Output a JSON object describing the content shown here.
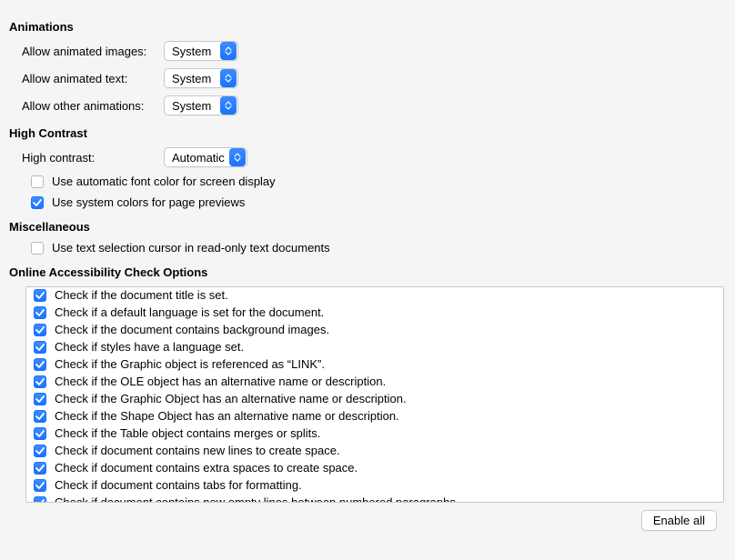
{
  "animations": {
    "header": "Animations",
    "rows": [
      {
        "label": "Allow animated images:",
        "value": "System"
      },
      {
        "label": "Allow animated text:",
        "value": "System"
      },
      {
        "label": "Allow other animations:",
        "value": "System"
      }
    ]
  },
  "highContrast": {
    "header": "High Contrast",
    "selectLabel": "High contrast:",
    "selectValue": "Automatic",
    "opts": [
      {
        "checked": false,
        "label": "Use automatic font color for screen display"
      },
      {
        "checked": true,
        "label": "Use system colors for page previews"
      }
    ]
  },
  "misc": {
    "header": "Miscellaneous",
    "opts": [
      {
        "checked": false,
        "label": "Use text selection cursor in read-only text documents"
      }
    ]
  },
  "accessibility": {
    "header": "Online Accessibility Check Options",
    "items": [
      {
        "checked": true,
        "label": "Check if the document title is set."
      },
      {
        "checked": true,
        "label": "Check if a default language is set for the document."
      },
      {
        "checked": true,
        "label": "Check if the document contains background images."
      },
      {
        "checked": true,
        "label": "Check if styles have a language set."
      },
      {
        "checked": true,
        "label": "Check if the Graphic object is referenced as “LINK”."
      },
      {
        "checked": true,
        "label": "Check if the OLE object has an alternative name or description."
      },
      {
        "checked": true,
        "label": "Check if the Graphic Object has an alternative name or description."
      },
      {
        "checked": true,
        "label": "Check if the Shape Object has an alternative name or description."
      },
      {
        "checked": true,
        "label": "Check if the Table object contains merges or splits."
      },
      {
        "checked": true,
        "label": "Check if document contains new lines to create space."
      },
      {
        "checked": true,
        "label": "Check if document contains extra spaces to create space."
      },
      {
        "checked": true,
        "label": "Check if document contains tabs for formatting."
      },
      {
        "checked": true,
        "label": "Check if document contains new empty lines between numbered paragraphs."
      }
    ]
  },
  "enableAll": "Enable all",
  "checkmarkSVG": "<svg width='10' height='10' viewBox='0 0 10 10'><path d='M1 5 L4 8 L9 2' stroke='#fff' stroke-width='1.8' fill='none' stroke-linecap='round' stroke-linejoin='round'/></svg>",
  "upDownSVG": "<svg width='8' height='5' viewBox='0 0 8 5'><path d='M1 4 L4 1 L7 4' stroke='#fff' stroke-width='1.2' fill='none' stroke-linecap='round' stroke-linejoin='round'/></svg><svg width='8' height='5' viewBox='0 0 8 5'><path d='M1 1 L4 4 L7 1' stroke='#fff' stroke-width='1.2' fill='none' stroke-linecap='round' stroke-linejoin='round'/></svg>"
}
